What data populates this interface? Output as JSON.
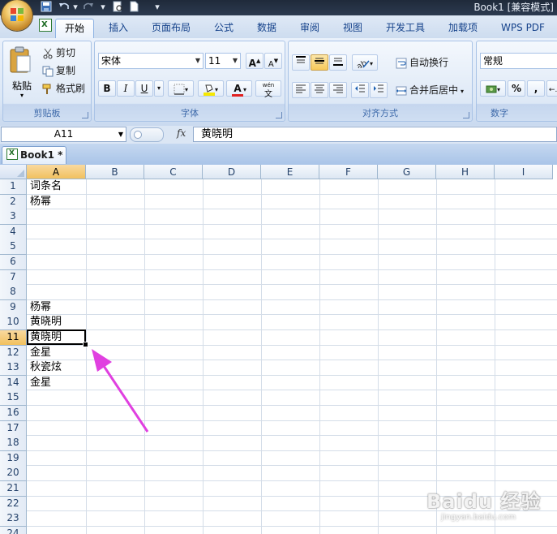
{
  "window": {
    "title": "Book1  [兼容模式]"
  },
  "tabs": [
    "开始",
    "插入",
    "页面布局",
    "公式",
    "数据",
    "审阅",
    "视图",
    "开发工具",
    "加载项",
    "WPS PDF"
  ],
  "active_tab": "开始",
  "clipboard": {
    "paste_label": "粘贴",
    "cut_label": "剪切",
    "copy_label": "复制",
    "format_painter_label": "格式刷",
    "group_label": "剪贴板"
  },
  "font": {
    "name": "宋体",
    "size": "11",
    "group_label": "字体",
    "bold": "B",
    "italic": "I",
    "underline": "U",
    "font_color_letter": "A",
    "phonetic": "wén",
    "phonetic_char": "文"
  },
  "alignment": {
    "wrap_text_label": "自动换行",
    "merge_center_label": "合并后居中",
    "group_label": "对齐方式"
  },
  "number": {
    "format": "常规",
    "percent": "%",
    "comma": ",",
    "group_label": "数字"
  },
  "formula_bar": {
    "name_box": "A11",
    "fx_label": "fx",
    "content": "黄晓明"
  },
  "workbook_tab": {
    "label": "Book1 *"
  },
  "grid": {
    "columns": [
      "A",
      "B",
      "C",
      "D",
      "E",
      "F",
      "G",
      "H",
      "I"
    ],
    "selected_column": "A",
    "rows": [
      "1",
      "2",
      "3",
      "4",
      "5",
      "6",
      "7",
      "8",
      "9",
      "10",
      "11",
      "12",
      "13",
      "14",
      "15",
      "16",
      "17",
      "18",
      "19",
      "20",
      "21",
      "22",
      "23",
      "24"
    ],
    "selected_row": "11",
    "cells_A": [
      "词条名",
      "杨幂",
      "",
      "",
      "",
      "",
      "",
      "",
      "杨幂",
      "黄晓明",
      "黄晓明",
      "金星",
      "秋瓷炫",
      "金星",
      "",
      "",
      "",
      "",
      "",
      "",
      "",
      "",
      "",
      ""
    ]
  },
  "watermark": {
    "main": "Baidu 经验",
    "sub": "jingyan.baidu.com"
  },
  "colors": {
    "accent_arrow": "#e040e0",
    "ribbon_text": "#15428b",
    "selected_header": "#f1c15f"
  }
}
